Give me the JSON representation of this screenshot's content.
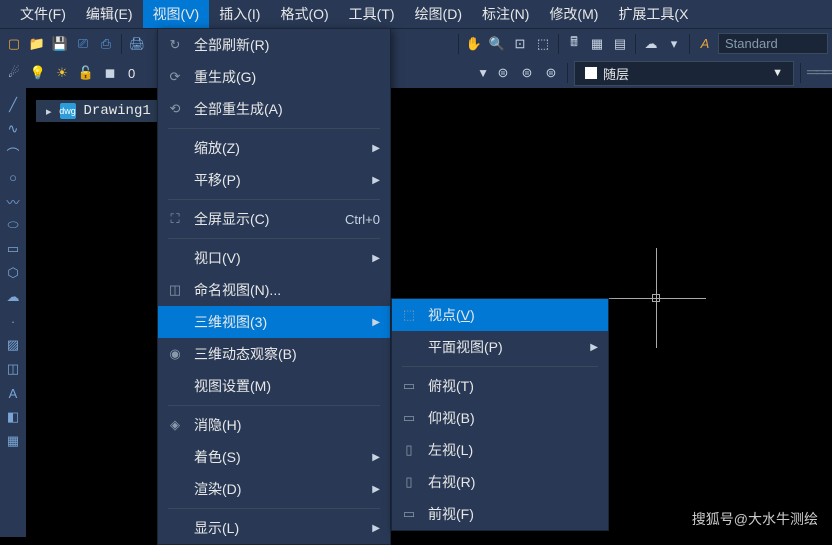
{
  "menubar": [
    "文件(F)",
    "编辑(E)",
    "视图(V)",
    "插入(I)",
    "格式(O)",
    "工具(T)",
    "绘图(D)",
    "标注(N)",
    "修改(M)",
    "扩展工具(X"
  ],
  "menubar_active": 2,
  "standard_label": "Standard",
  "layer_label": "随层",
  "tab_label": "Drawing1",
  "view_menu": [
    {
      "type": "item",
      "label": "全部刷新(R)",
      "icon": "↻"
    },
    {
      "type": "item",
      "label": "重生成(G)",
      "icon": "⟳"
    },
    {
      "type": "item",
      "label": "全部重生成(A)",
      "icon": "⟲"
    },
    {
      "type": "sep"
    },
    {
      "type": "item",
      "label": "缩放(Z)",
      "arrow": true
    },
    {
      "type": "item",
      "label": "平移(P)",
      "arrow": true
    },
    {
      "type": "sep"
    },
    {
      "type": "item",
      "label": "全屏显示(C)",
      "icon": "⛶",
      "shortcut": "Ctrl+0"
    },
    {
      "type": "sep"
    },
    {
      "type": "item",
      "label": "视口(V)",
      "arrow": true
    },
    {
      "type": "item",
      "label": "命名视图(N)...",
      "icon": "◫"
    },
    {
      "type": "item",
      "label": "三维视图(3)",
      "arrow": true,
      "highlight": true
    },
    {
      "type": "item",
      "label": "三维动态观察(B)",
      "icon": "◉"
    },
    {
      "type": "item",
      "label": "视图设置(M)"
    },
    {
      "type": "sep"
    },
    {
      "type": "item",
      "label": "消隐(H)",
      "icon": "◈"
    },
    {
      "type": "item",
      "label": "着色(S)",
      "arrow": true
    },
    {
      "type": "item",
      "label": "渲染(D)",
      "arrow": true
    },
    {
      "type": "sep"
    },
    {
      "type": "item",
      "label": "显示(L)",
      "arrow": true
    }
  ],
  "submenu": [
    {
      "type": "item",
      "label": "视点(V)",
      "icon": "⬚",
      "highlight": true,
      "underline": "V"
    },
    {
      "type": "item",
      "label": "平面视图(P)",
      "arrow": true
    },
    {
      "type": "sep"
    },
    {
      "type": "item",
      "label": "俯视(T)",
      "icon": "▭"
    },
    {
      "type": "item",
      "label": "仰视(B)",
      "icon": "▭"
    },
    {
      "type": "item",
      "label": "左视(L)",
      "icon": "▯"
    },
    {
      "type": "item",
      "label": "右视(R)",
      "icon": "▯"
    },
    {
      "type": "item",
      "label": "前视(F)",
      "icon": "▭"
    }
  ],
  "watermark": "搜狐号@大水牛测绘"
}
